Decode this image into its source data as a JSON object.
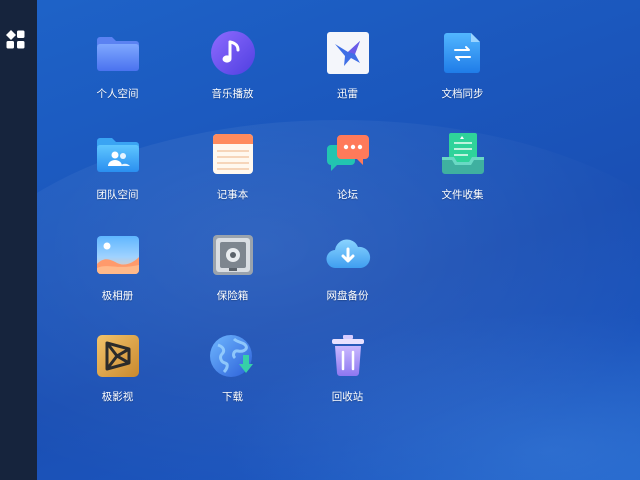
{
  "sidebar": {
    "launcher_icon": "grid-apps-icon"
  },
  "apps": [
    {
      "label": "个人空间",
      "icon": "folder-icon"
    },
    {
      "label": "音乐播放",
      "icon": "music-note-icon"
    },
    {
      "label": "迅雷",
      "icon": "thunder-bird-icon"
    },
    {
      "label": "文档同步",
      "icon": "sync-document-icon"
    },
    {
      "label": "团队空间",
      "icon": "team-folder-icon"
    },
    {
      "label": "记事本",
      "icon": "notepad-icon"
    },
    {
      "label": "论坛",
      "icon": "chat-bubbles-icon"
    },
    {
      "label": "文件收集",
      "icon": "file-inbox-icon"
    },
    {
      "label": "极相册",
      "icon": "photo-album-icon"
    },
    {
      "label": "保险箱",
      "icon": "safe-icon"
    },
    {
      "label": "网盘备份",
      "icon": "cloud-download-icon"
    },
    {
      "label": "极影视",
      "icon": "video-icon"
    },
    {
      "label": "下载",
      "icon": "globe-download-icon"
    },
    {
      "label": "回收站",
      "icon": "trash-icon"
    }
  ]
}
